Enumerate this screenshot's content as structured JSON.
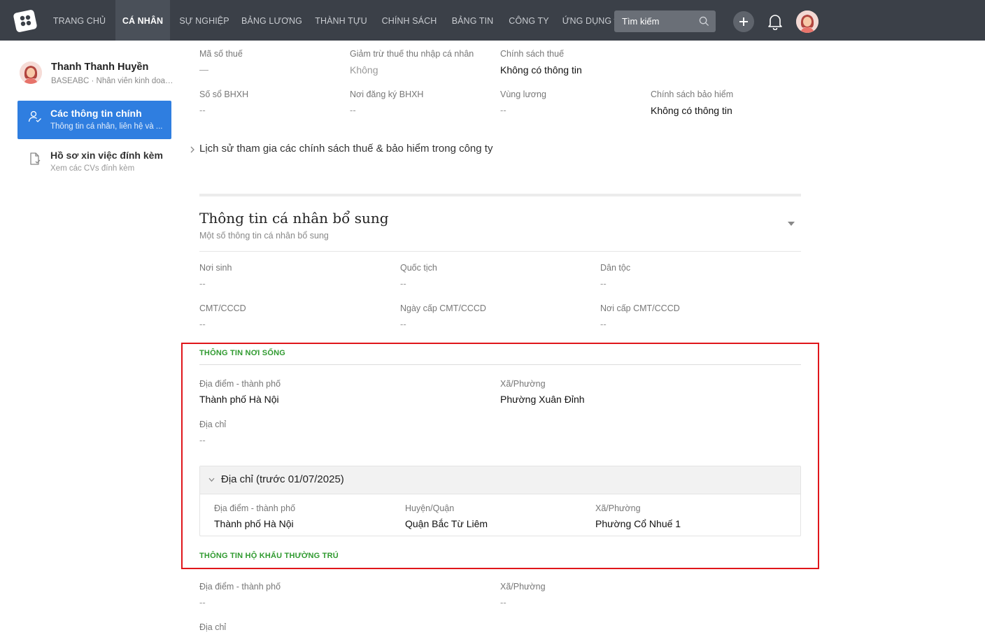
{
  "nav": {
    "items": [
      "TRANG CHỦ",
      "CÁ NHÂN",
      "SỰ NGHIỆP",
      "BẢNG LƯƠNG",
      "THÀNH TỰU",
      "CHÍNH SÁCH",
      "BẢNG TIN",
      "CÔNG TY",
      "ỨNG DỤNG"
    ],
    "active_index": 1,
    "search_placeholder": "Tìm kiếm"
  },
  "profile": {
    "name": "Thanh Thanh Huyền",
    "subtitle": "BASEABC · Nhân viên kinh doanh"
  },
  "sidebar": {
    "items": [
      {
        "title": "Các thông tin chính",
        "subtitle": "Thông tin cá nhân, liên hệ và ...",
        "icon": "user-check-icon",
        "active": true
      },
      {
        "title": "Hồ sơ xin việc đính kèm",
        "subtitle": "Xem các CVs đính kèm",
        "icon": "file-check-icon",
        "active": false
      }
    ]
  },
  "tax": {
    "tax_code": {
      "label": "Mã số thuế",
      "value": "—"
    },
    "deduction": {
      "label": "Giảm trừ thuế thu nhập cá nhân",
      "value": "Không"
    },
    "tax_policy": {
      "label": "Chính sách thuế",
      "value": "Không có thông tin"
    },
    "bhxh_no": {
      "label": "Số sổ BHXH",
      "value": "--"
    },
    "bhxh_place": {
      "label": "Nơi đăng ký BHXH",
      "value": "--"
    },
    "salary_zone": {
      "label": "Vùng lương",
      "value": "--"
    },
    "insurance_policy": {
      "label": "Chính sách bảo hiểm",
      "value": "Không có thông tin"
    },
    "history_link": "Lịch sử tham gia các chính sách thuế & bảo hiểm trong công ty"
  },
  "extra": {
    "title": "Thông tin cá nhân bổ sung",
    "subtitle": "Một số thông tin cá nhân bổ sung",
    "birthplace": {
      "label": "Nơi sinh",
      "value": "--"
    },
    "nationality": {
      "label": "Quốc tịch",
      "value": "--"
    },
    "ethnicity": {
      "label": "Dân tộc",
      "value": "--"
    },
    "id_no": {
      "label": "CMT/CCCD",
      "value": "--"
    },
    "id_date": {
      "label": "Ngày cấp CMT/CCCD",
      "value": "--"
    },
    "id_place": {
      "label": "Nơi cấp CMT/CCCD",
      "value": "--"
    }
  },
  "residence": {
    "heading": "THÔNG TIN NƠI SỐNG",
    "city": {
      "label": "Địa điểm - thành phố",
      "value": "Thành phố Hà Nội"
    },
    "ward": {
      "label": "Xã/Phường",
      "value": "Phường Xuân Đỉnh"
    },
    "address": {
      "label": "Địa chỉ",
      "value": "--"
    },
    "old_address": {
      "title": "Địa chỉ (trước 01/07/2025)",
      "city": {
        "label": "Địa điểm - thành phố",
        "value": "Thành phố Hà Nội"
      },
      "district": {
        "label": "Huyện/Quận",
        "value": "Quận Bắc Từ Liêm"
      },
      "ward": {
        "label": "Xã/Phường",
        "value": "Phường Cổ Nhuế 1"
      }
    }
  },
  "permanent": {
    "heading": "THÔNG TIN HỘ KHẨU THƯỜNG TRÚ",
    "city": {
      "label": "Địa điểm - thành phố",
      "value": "--"
    },
    "ward": {
      "label": "Xã/Phường",
      "value": "--"
    },
    "address": {
      "label": "Địa chỉ"
    }
  },
  "colors": {
    "topbar": "#3b4048",
    "accent": "#2f7ee0",
    "section_green": "#2f9a2f",
    "highlight_red": "#e0161b"
  }
}
